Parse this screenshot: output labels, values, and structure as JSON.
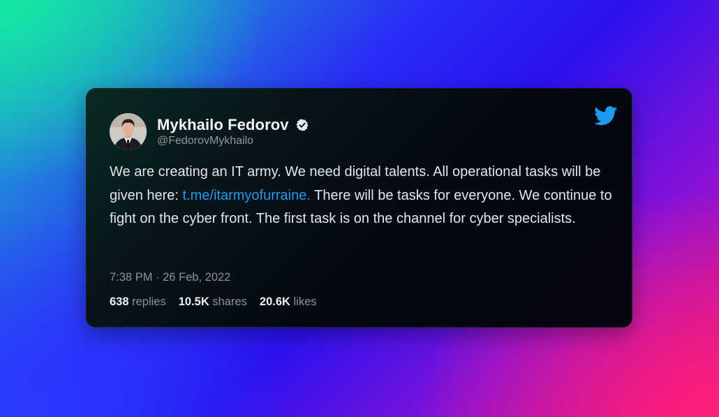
{
  "tweet": {
    "author_name": "Mykhailo Fedorov",
    "author_handle": "@FedorovMykhailo",
    "verified_icon": "verified-badge-icon",
    "platform_icon": "twitter-bird-icon",
    "text_part1": "We are creating an IT army. We need digital talents. All operational tasks will be given here: ",
    "link_text": "t.me/itarmyofurraine.",
    "text_part2": " There will be tasks for everyone. We continue to fight on the cyber front. The first task is on the channel for cyber specialists.",
    "timestamp": "7:38 PM · 26 Feb, 2022",
    "stats": {
      "replies_value": "638",
      "replies_label": "replies",
      "shares_value": "10.5K",
      "shares_label": "shares",
      "likes_value": "20.6K",
      "likes_label": "likes"
    }
  },
  "colors": {
    "link": "#1d9bf0",
    "card_background": "#050810",
    "twitter_blue": "#1d9bf0"
  }
}
